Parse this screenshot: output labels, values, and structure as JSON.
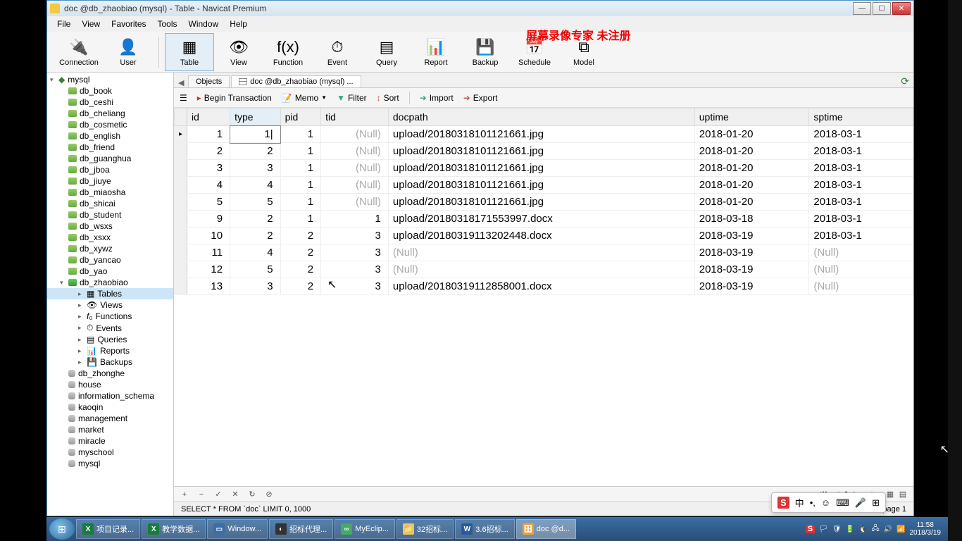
{
  "window": {
    "title": "doc @db_zhaobiao (mysql) - Table - Navicat Premium"
  },
  "overlay": "屏幕录像专家  未注册",
  "menu": [
    "File",
    "View",
    "Favorites",
    "Tools",
    "Window",
    "Help"
  ],
  "toolbar": [
    {
      "label": "Connection",
      "glyph": "🔌"
    },
    {
      "label": "User",
      "glyph": "👤"
    },
    {
      "label": "Table",
      "glyph": "▦",
      "active": true
    },
    {
      "label": "View",
      "glyph": "👁"
    },
    {
      "label": "Function",
      "glyph": "f(x)"
    },
    {
      "label": "Event",
      "glyph": "⏱"
    },
    {
      "label": "Query",
      "glyph": "▤"
    },
    {
      "label": "Report",
      "glyph": "📊"
    },
    {
      "label": "Backup",
      "glyph": "💾"
    },
    {
      "label": "Schedule",
      "glyph": "📅"
    },
    {
      "label": "Model",
      "glyph": "⧉"
    }
  ],
  "sidebar": {
    "root": "mysql",
    "dbs": [
      "db_book",
      "db_ceshi",
      "db_cheliang",
      "db_cosmetic",
      "db_english",
      "db_friend",
      "db_guanghua",
      "db_jboa",
      "db_jiuye",
      "db_miaosha",
      "db_shicai",
      "db_student",
      "db_wsxs",
      "db_xsxx",
      "db_xywz",
      "db_yancao",
      "db_yao"
    ],
    "current_db": "db_zhaobiao",
    "db_children": [
      "Tables",
      "Views",
      "Functions",
      "Events",
      "Queries",
      "Reports",
      "Backups"
    ],
    "more_dbs": [
      "db_zhonghe",
      "house",
      "information_schema",
      "kaoqin",
      "management",
      "market",
      "miracle",
      "myschool",
      "mysql"
    ]
  },
  "tabs": {
    "objects": "Objects",
    "current": "doc @db_zhaobiao (mysql) ..."
  },
  "subtoolbar": {
    "begin": "Begin Transaction",
    "memo": "Memo",
    "filter": "Filter",
    "sort": "Sort",
    "import": "Import",
    "export": "Export"
  },
  "columns": [
    "id",
    "type",
    "pid",
    "tid",
    "docpath",
    "uptime",
    "sptime"
  ],
  "active_col": 1,
  "editing_cell": {
    "row": 0,
    "col": 1,
    "value": "1"
  },
  "rows": [
    {
      "id": 1,
      "type": 1,
      "pid": 1,
      "tid": null,
      "docpath": "upload/20180318101121661.jpg",
      "uptime": "2018-01-20",
      "sptime": "2018-03-1"
    },
    {
      "id": 2,
      "type": 2,
      "pid": 1,
      "tid": null,
      "docpath": "upload/20180318101121661.jpg",
      "uptime": "2018-01-20",
      "sptime": "2018-03-1"
    },
    {
      "id": 3,
      "type": 3,
      "pid": 1,
      "tid": null,
      "docpath": "upload/20180318101121661.jpg",
      "uptime": "2018-01-20",
      "sptime": "2018-03-1"
    },
    {
      "id": 4,
      "type": 4,
      "pid": 1,
      "tid": null,
      "docpath": "upload/20180318101121661.jpg",
      "uptime": "2018-01-20",
      "sptime": "2018-03-1"
    },
    {
      "id": 5,
      "type": 5,
      "pid": 1,
      "tid": null,
      "docpath": "upload/20180318101121661.jpg",
      "uptime": "2018-01-20",
      "sptime": "2018-03-1"
    },
    {
      "id": 9,
      "type": 2,
      "pid": 1,
      "tid": 1,
      "docpath": "upload/20180318171553997.docx",
      "uptime": "2018-03-18",
      "sptime": "2018-03-1"
    },
    {
      "id": 10,
      "type": 2,
      "pid": 2,
      "tid": 3,
      "docpath": "upload/20180319113202448.docx",
      "uptime": "2018-03-19",
      "sptime": "2018-03-1"
    },
    {
      "id": 11,
      "type": 4,
      "pid": 2,
      "tid": 3,
      "docpath": null,
      "uptime": "2018-03-19",
      "sptime": null
    },
    {
      "id": 12,
      "type": 5,
      "pid": 2,
      "tid": 3,
      "docpath": null,
      "uptime": "2018-03-19",
      "sptime": null
    },
    {
      "id": 13,
      "type": 3,
      "pid": 2,
      "tid": 3,
      "docpath": "upload/20180319112858001.docx",
      "uptime": "2018-03-19",
      "sptime": null
    }
  ],
  "footer": {
    "nav_page": "1"
  },
  "status": {
    "query": "SELECT * FROM `doc` LIMIT 0, 1000",
    "right": "n page 1"
  },
  "taskbar": {
    "items": [
      {
        "label": "项目记录...",
        "glyph": "X",
        "color": "#1a7c3c"
      },
      {
        "label": "教学数据...",
        "glyph": "X",
        "color": "#1a7c3c"
      },
      {
        "label": "Window...",
        "glyph": "▭",
        "color": "#3a6ea5"
      },
      {
        "label": "招标代理...",
        "glyph": "◐",
        "color": "#333"
      },
      {
        "label": "MyEclip...",
        "glyph": "∞",
        "color": "#4a6"
      },
      {
        "label": "32招标...",
        "glyph": "📁",
        "color": "#e8c56a"
      },
      {
        "label": "3.6招标...",
        "glyph": "W",
        "color": "#2a5a9c"
      },
      {
        "label": "doc @d...",
        "glyph": "🗄",
        "color": "#e8a23c",
        "active": true
      }
    ],
    "tray_s": "S",
    "clock_time": "11:58",
    "clock_date": "2018/3/19"
  },
  "ime": {
    "s": "S",
    "cn": "中"
  }
}
